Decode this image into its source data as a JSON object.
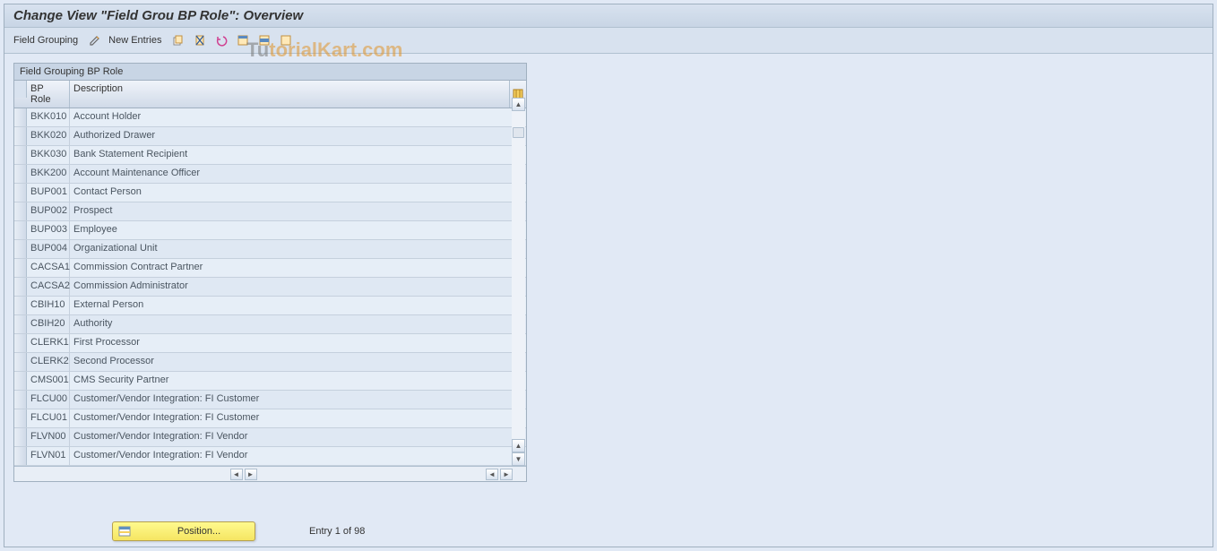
{
  "title": "Change View \"Field Grou BP Role\": Overview",
  "toolbar": {
    "field_grouping": "Field Grouping",
    "new_entries": "New Entries"
  },
  "watermark": {
    "a": "Tu",
    "b": "torialKart.com"
  },
  "panel": {
    "header": "Field Grouping BP Role",
    "columns": {
      "role": "BP Role",
      "desc": "Description"
    }
  },
  "rows": [
    {
      "role": "BKK010",
      "desc": "Account Holder"
    },
    {
      "role": "BKK020",
      "desc": "Authorized Drawer"
    },
    {
      "role": "BKK030",
      "desc": "Bank Statement Recipient"
    },
    {
      "role": "BKK200",
      "desc": "Account Maintenance Officer"
    },
    {
      "role": "BUP001",
      "desc": "Contact Person"
    },
    {
      "role": "BUP002",
      "desc": "Prospect"
    },
    {
      "role": "BUP003",
      "desc": "Employee"
    },
    {
      "role": "BUP004",
      "desc": "Organizational Unit"
    },
    {
      "role": "CACSA1",
      "desc": "Commission Contract Partner"
    },
    {
      "role": "CACSA2",
      "desc": "Commission Administrator"
    },
    {
      "role": "CBIH10",
      "desc": "External Person"
    },
    {
      "role": "CBIH20",
      "desc": "Authority"
    },
    {
      "role": "CLERK1",
      "desc": "First Processor"
    },
    {
      "role": "CLERK2",
      "desc": "Second Processor"
    },
    {
      "role": "CMS001",
      "desc": "CMS Security Partner"
    },
    {
      "role": "FLCU00",
      "desc": "Customer/Vendor Integration: FI Customer"
    },
    {
      "role": "FLCU01",
      "desc": "Customer/Vendor Integration: FI Customer"
    },
    {
      "role": "FLVN00",
      "desc": "Customer/Vendor Integration: FI Vendor"
    },
    {
      "role": "FLVN01",
      "desc": "Customer/Vendor Integration: FI Vendor"
    }
  ],
  "footer": {
    "position_btn": "Position...",
    "entry_text": "Entry 1 of 98"
  }
}
